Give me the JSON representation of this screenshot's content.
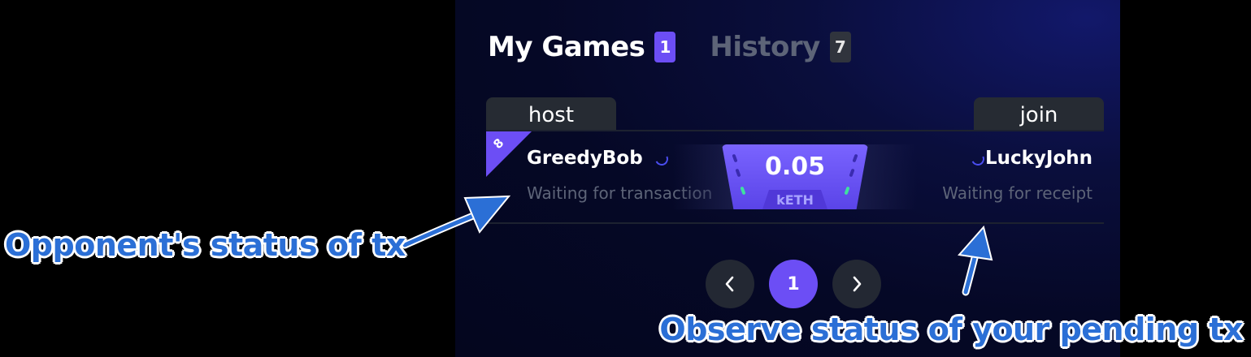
{
  "tabs": {
    "my_games": {
      "label": "My Games",
      "count": "1"
    },
    "history": {
      "label": "History",
      "count": "7"
    }
  },
  "game": {
    "host_label": "host",
    "join_label": "join",
    "corner_number": "8",
    "host": {
      "name": "GreedyBob",
      "status": "Waiting for transaction"
    },
    "joiner": {
      "name": "LuckyJohn",
      "status": "Waiting for receipt"
    },
    "stake": {
      "value": "0.05",
      "unit": "kETH"
    }
  },
  "pagination": {
    "current_page": "1"
  },
  "annotations": {
    "left": "Opponent's status of tx",
    "right": "Observe status of your pending tx"
  },
  "colors": {
    "accent": "#6c4ef5",
    "muted_text": "#5d6478",
    "annotation": "#2b6fd6",
    "success_tick": "#3fe0a0"
  },
  "icons": {
    "prev": "chevron-left-icon",
    "next": "chevron-right-icon",
    "loading": "spinner-icon"
  }
}
